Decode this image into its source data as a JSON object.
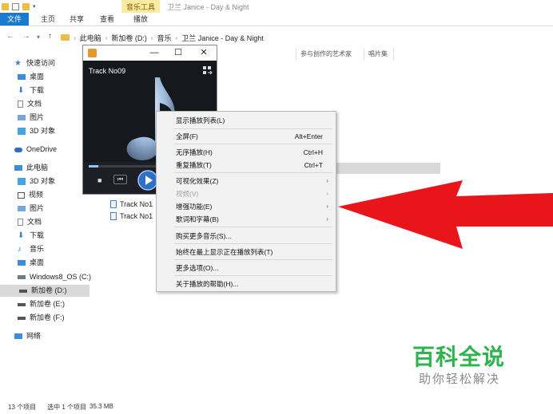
{
  "ribbon": {
    "context_tab_label": "音乐工具",
    "window_title": "卫兰 Janice - Day & Night",
    "tabs": [
      "文件",
      "主页",
      "共享",
      "查看",
      "播放"
    ]
  },
  "address": {
    "crumbs": [
      "此电脑",
      "新加卷 (D:)",
      "音乐",
      "卫兰 Janice - Day & Night"
    ]
  },
  "columns": [
    "参与创作的艺术家",
    "唱片集"
  ],
  "sidebar": {
    "items": [
      {
        "label": "快速访问",
        "icon": "star-icon"
      },
      {
        "label": "桌面",
        "icon": "desktop-icon"
      },
      {
        "label": "下载",
        "icon": "download-icon"
      },
      {
        "label": "文档",
        "icon": "document-icon"
      },
      {
        "label": "图片",
        "icon": "picture-icon"
      },
      {
        "label": "3D 对象",
        "icon": "cube-icon"
      },
      {
        "label": "OneDrive",
        "icon": "cloud-icon"
      },
      {
        "label": "此电脑",
        "icon": "computer-icon"
      },
      {
        "label": "3D 对象",
        "icon": "cube-icon"
      },
      {
        "label": "视频",
        "icon": "video-icon"
      },
      {
        "label": "图片",
        "icon": "picture-icon"
      },
      {
        "label": "文档",
        "icon": "document-icon"
      },
      {
        "label": "下载",
        "icon": "download-icon"
      },
      {
        "label": "音乐",
        "icon": "music-icon"
      },
      {
        "label": "桌面",
        "icon": "desktop-icon"
      },
      {
        "label": "Windows8_OS (C:)",
        "icon": "drive-icon"
      },
      {
        "label": "新加卷 (D:)",
        "icon": "drive-icon"
      },
      {
        "label": "新加卷 (E:)",
        "icon": "drive-icon"
      },
      {
        "label": "新加卷 (F:)",
        "icon": "drive-icon"
      },
      {
        "label": "网络",
        "icon": "network-icon"
      }
    ]
  },
  "files": [
    "Track No1",
    "Track No1"
  ],
  "player": {
    "track_title": "Track No09",
    "minimize": "—",
    "maximize": "☐",
    "close": "✕"
  },
  "context_menu": {
    "items": [
      {
        "label": "显示播放列表(L)",
        "shortcut": "",
        "submenu": false,
        "disabled": false
      },
      {
        "label": "全屏(F)",
        "shortcut": "Alt+Enter",
        "submenu": false,
        "disabled": false
      },
      {
        "label": "无序播放(H)",
        "shortcut": "Ctrl+H",
        "submenu": false,
        "disabled": false
      },
      {
        "label": "重复播放(T)",
        "shortcut": "Ctrl+T",
        "submenu": false,
        "disabled": false
      },
      {
        "label": "可视化效果(Z)",
        "shortcut": "",
        "submenu": true,
        "disabled": false
      },
      {
        "label": "视频(V)",
        "shortcut": "",
        "submenu": true,
        "disabled": true
      },
      {
        "label": "增强功能(E)",
        "shortcut": "",
        "submenu": true,
        "disabled": false
      },
      {
        "label": "歌词和字幕(B)",
        "shortcut": "",
        "submenu": true,
        "disabled": false
      },
      {
        "label": "购买更多音乐(S)...",
        "shortcut": "",
        "submenu": false,
        "disabled": false
      },
      {
        "label": "始终在最上显示正在播放列表(T)",
        "shortcut": "",
        "submenu": false,
        "disabled": false
      },
      {
        "label": "更多选项(O)...",
        "shortcut": "",
        "submenu": false,
        "disabled": false
      },
      {
        "label": "关于播放的帮助(H)...",
        "shortcut": "",
        "submenu": false,
        "disabled": false
      }
    ]
  },
  "status": {
    "item_count": "13 个项目",
    "selection": "选中 1 个项目",
    "size": "35.3 MB"
  },
  "watermark": {
    "title": "百科全说",
    "subtitle": "助你轻松解决"
  },
  "colors": {
    "accent": "#1979ca",
    "context_tab": "#fbeba2",
    "arrow": "#e8151b",
    "watermark": "#2eb34f"
  }
}
